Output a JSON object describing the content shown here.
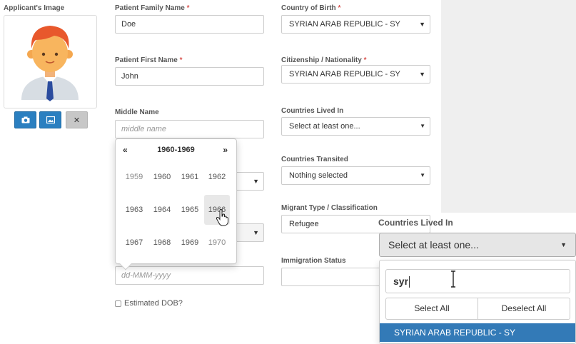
{
  "applicant": {
    "image_label": "Applicant's Image"
  },
  "photo_buttons": {
    "camera_icon": "camera-icon",
    "gallery_icon": "image-icon",
    "remove_label": "✕"
  },
  "fields": {
    "family_name": {
      "label": "Patient Family Name",
      "required": "*",
      "value": "Doe"
    },
    "first_name": {
      "label": "Patient First Name",
      "required": "*",
      "value": "John"
    },
    "middle_name": {
      "label": "Middle Name",
      "placeholder": "middle name"
    },
    "dob": {
      "placeholder": "dd-MMM-yyyy"
    },
    "estimated_dob": {
      "label": "Estimated DOB?",
      "checked": false
    },
    "country_of_birth": {
      "label": "Country of Birth",
      "required": "*",
      "value": "SYRIAN ARAB REPUBLIC - SY"
    },
    "citizenship": {
      "label": "Citizenship / Nationality",
      "required": "*",
      "value": "SYRIAN ARAB REPUBLIC - SY"
    },
    "countries_lived_in": {
      "label": "Countries Lived In",
      "value": "Select at least one..."
    },
    "countries_transited": {
      "label": "Countries Transited",
      "value": "Nothing selected"
    },
    "migrant_type": {
      "label": "Migrant Type / Classification",
      "value": "Refugee"
    },
    "immigration_status": {
      "label": "Immigration Status",
      "value": ""
    }
  },
  "datepicker": {
    "prev": "«",
    "next": "»",
    "decade": "1960-1969",
    "years": [
      "1959",
      "1960",
      "1961",
      "1962",
      "1963",
      "1964",
      "1965",
      "1966",
      "1967",
      "1968",
      "1969",
      "1970"
    ],
    "hovered_year": "1966"
  },
  "countries_popup": {
    "title": "Countries Lived In",
    "button_text": "Select at least one...",
    "search_value": "syr",
    "select_all": "Select All",
    "deselect_all": "Deselect All",
    "results": [
      "SYRIAN ARAB REPUBLIC - SY"
    ]
  },
  "colors": {
    "primary": "#337ab7",
    "button_blue": "#2a7fc0",
    "required": "#d9534f",
    "panel_gray": "#efefef"
  }
}
